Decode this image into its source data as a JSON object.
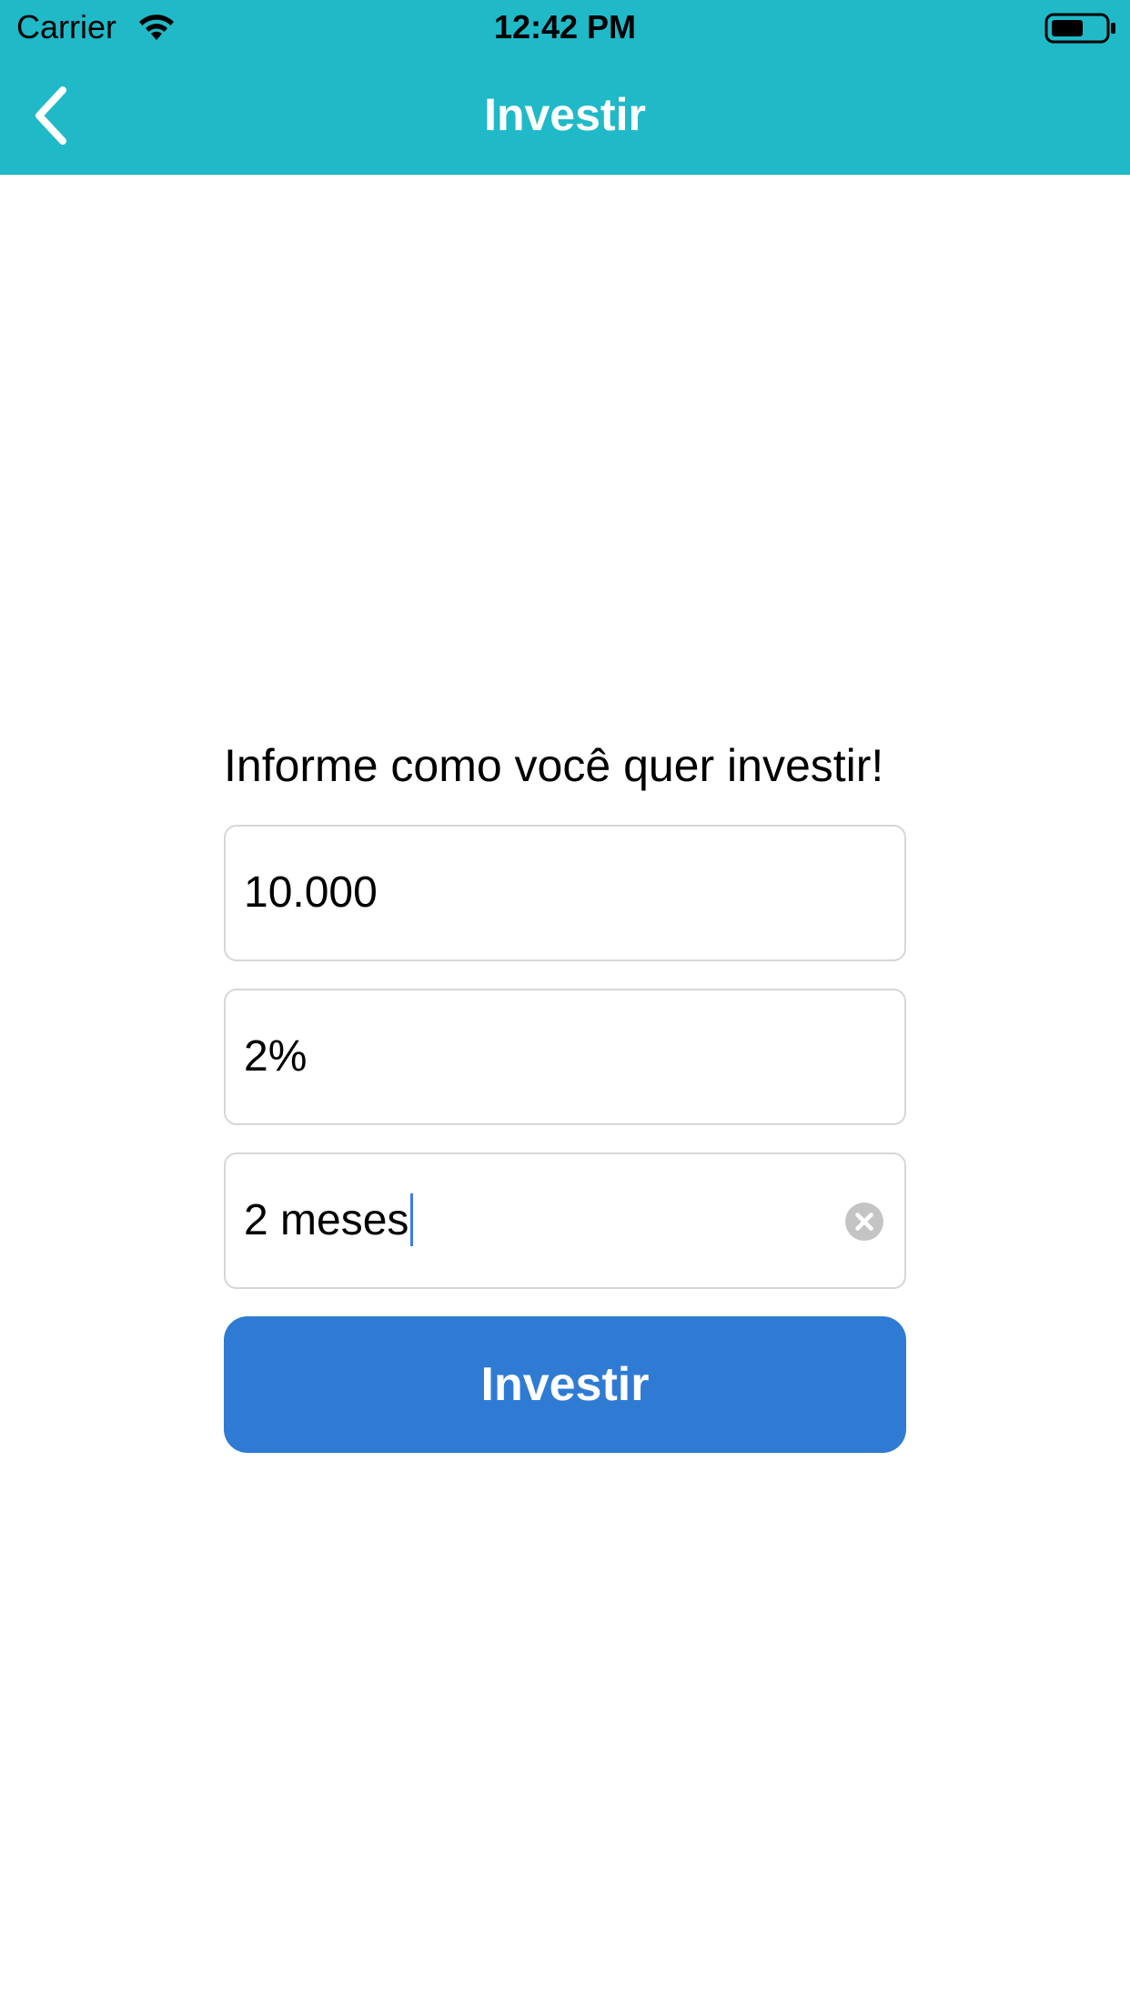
{
  "status_bar": {
    "carrier": "Carrier",
    "time": "12:42 PM",
    "icons": [
      "wifi-icon",
      "battery-icon"
    ]
  },
  "nav": {
    "title": "Investir",
    "back_icon": "chevron-left-icon"
  },
  "colors": {
    "header_bg": "#20b9c8",
    "button_bg": "#2f7bd4",
    "field_border": "#d6d6d6",
    "caret": "#3b7bf0"
  },
  "form": {
    "prompt": "Informe como você quer investir!",
    "fields": [
      {
        "value": "10.000"
      },
      {
        "value": "2%"
      },
      {
        "value": "2 meses",
        "focused": true,
        "clear_icon": "clear-circle-icon"
      }
    ],
    "submit_label": "Investir"
  }
}
